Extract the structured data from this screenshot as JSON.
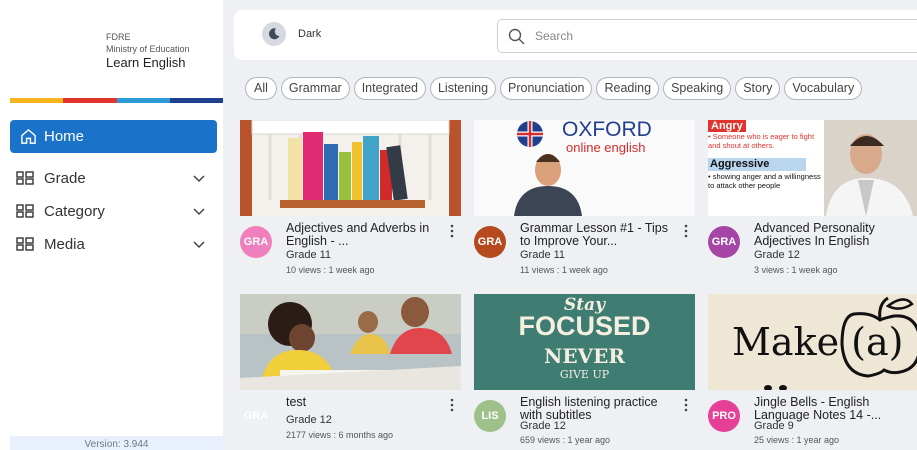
{
  "brand": {
    "line1": "FDRE",
    "line2": "Ministry of Education",
    "line3": "Learn English"
  },
  "stripe_colors": [
    "#f5b51b",
    "#e2332f",
    "#2b9ad6",
    "#1f3f8f"
  ],
  "nav": {
    "home": "Home",
    "items": [
      {
        "label": "Grade"
      },
      {
        "label": "Category"
      },
      {
        "label": "Media"
      }
    ]
  },
  "version": "Version: 3.944",
  "theme_toggle": {
    "label": "Dark"
  },
  "search": {
    "placeholder": "Search",
    "value": ""
  },
  "chips": [
    "All",
    "Grammar",
    "Integrated",
    "Listening",
    "Pronunciation",
    "Reading",
    "Speaking",
    "Story",
    "Vocabulary"
  ],
  "thumbnails": {
    "oxford_logo": "OXFORD",
    "oxford_sub": "online english",
    "angry_word": "Angry",
    "angry_desc": "• Someone who is eager to fight and shout at others.",
    "aggressive_word": "Aggressive",
    "aggressive_desc": "• showing anger and a willingness to attack other people",
    "stay": "Stay",
    "focused": "FOCUSED",
    "never": "NEVER",
    "give_up": "GIVE UP",
    "make_a": "Make (a)"
  },
  "cards": [
    {
      "avatar": "GRA",
      "avatar_color": "#f07fbd",
      "title": "Adjectives and Adverbs in English - ...",
      "grade": "Grade 11",
      "views": "10 views : 1 week ago"
    },
    {
      "avatar": "GRA",
      "avatar_color": "#b54a1f",
      "title": "Grammar Lesson #1 - Tips to Improve Your...",
      "grade": "Grade 11",
      "views": "11 views : 1 week ago"
    },
    {
      "avatar": "GRA",
      "avatar_color": "#a546a7",
      "title": "Advanced Personality Adjectives In English",
      "grade": "Grade 12",
      "views": "3 views : 1 week ago"
    },
    {
      "avatar": "GRA",
      "avatar_color": "#eef0f3",
      "title": "test",
      "grade": "Grade 12",
      "views": "2177 views : 6 months ago"
    },
    {
      "avatar": "LIS",
      "avatar_color": "#9ec08a",
      "title": "English listening practice with subtitles",
      "grade": "Grade 12",
      "views": "659 views : 1 year ago"
    },
    {
      "avatar": "PRO",
      "avatar_color": "#e53f98",
      "title": "Jingle Bells - English Language Notes 14 -...",
      "grade": "Grade 9",
      "views": "25 views : 1 year ago"
    }
  ]
}
